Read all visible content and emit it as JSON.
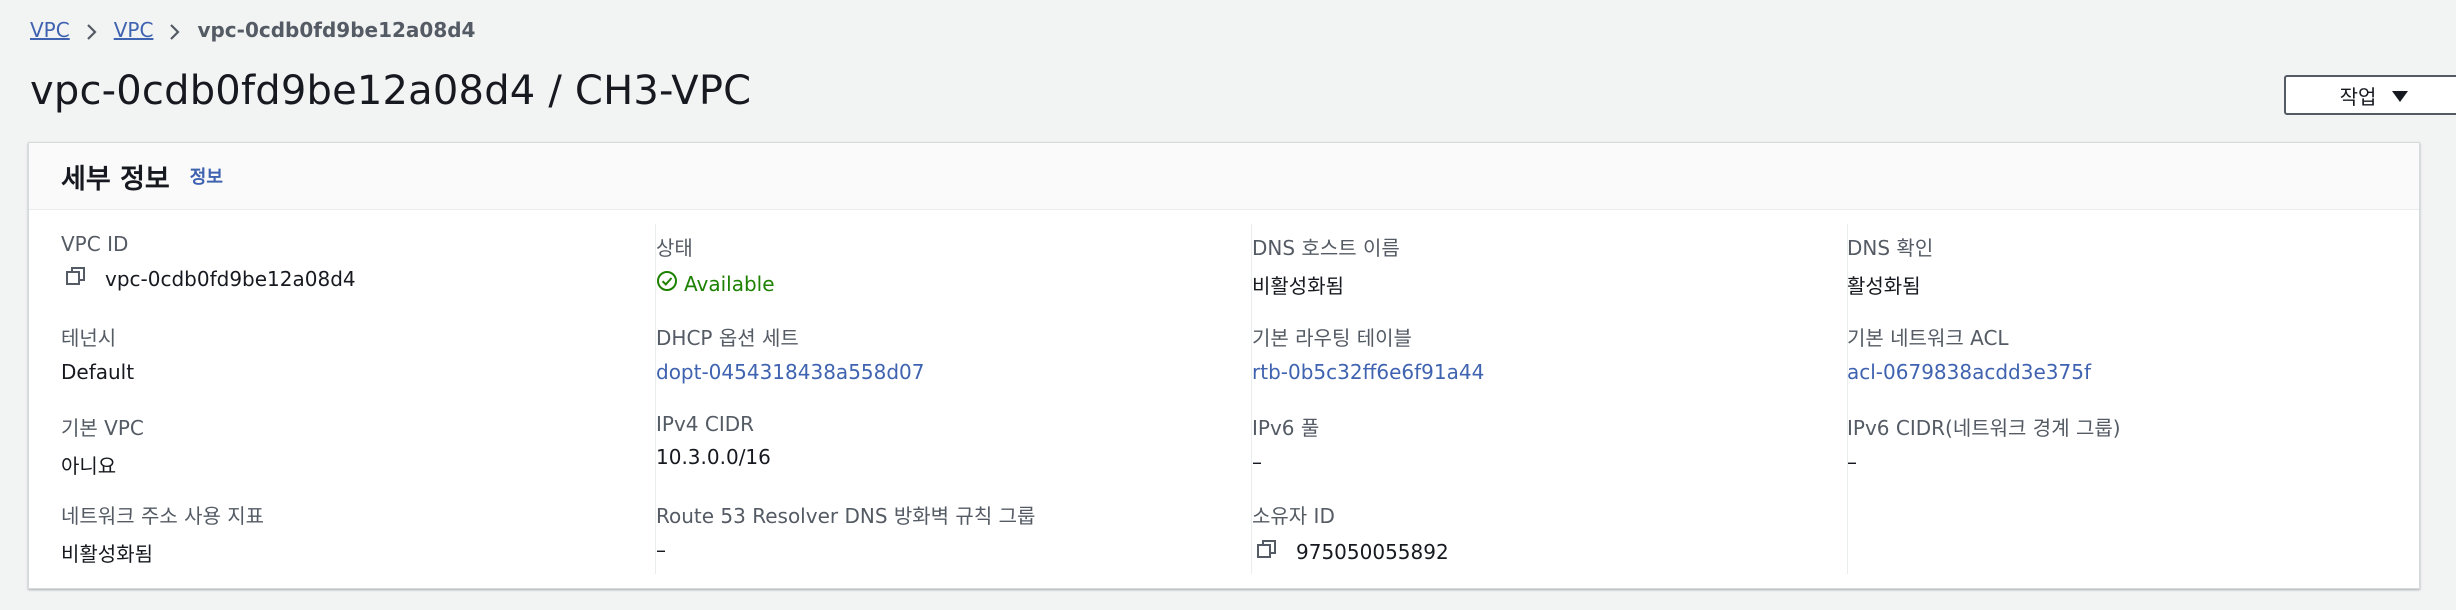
{
  "breadcrumb": {
    "items": [
      "VPC",
      "VPC"
    ],
    "current": "vpc-0cdb0fd9be12a08d4"
  },
  "page": {
    "title": "vpc-0cdb0fd9be12a08d4 / CH3-VPC",
    "actions_label": "작업"
  },
  "details": {
    "title": "세부 정보",
    "info_label": "정보",
    "columns": [
      [
        {
          "label": "VPC ID",
          "value": "vpc-0cdb0fd9be12a08d4"
        },
        {
          "label": "테넌시",
          "value": "Default"
        },
        {
          "label": "기본 VPC",
          "value": "아니요"
        },
        {
          "label": "네트워크 주소 사용 지표",
          "value": "비활성화됨"
        }
      ],
      [
        {
          "label": "상태",
          "value": "Available"
        },
        {
          "label": "DHCP 옵션 세트",
          "value": "dopt-0454318438a558d07"
        },
        {
          "label": "IPv4 CIDR",
          "value": "10.3.0.0/16"
        },
        {
          "label": "Route 53 Resolver DNS 방화벽 규칙 그룹",
          "value": "–"
        }
      ],
      [
        {
          "label": "DNS 호스트 이름",
          "value": "비활성화됨"
        },
        {
          "label": "기본 라우팅 테이블",
          "value": "rtb-0b5c32ff6e6f91a44"
        },
        {
          "label": "IPv6 풀",
          "value": "–"
        },
        {
          "label": "소유자 ID",
          "value": "975050055892"
        }
      ],
      [
        {
          "label": "DNS 확인",
          "value": "활성화됨"
        },
        {
          "label": "기본 네트워크 ACL",
          "value": "acl-0679838acdd3e375f"
        },
        {
          "label": "IPv6 CIDR(네트워크 경계 그룹)",
          "value": "–"
        }
      ]
    ]
  },
  "colors": {
    "link": "#3f63b0",
    "status_ok": "#1d8102",
    "background": "#f2f3f3"
  }
}
